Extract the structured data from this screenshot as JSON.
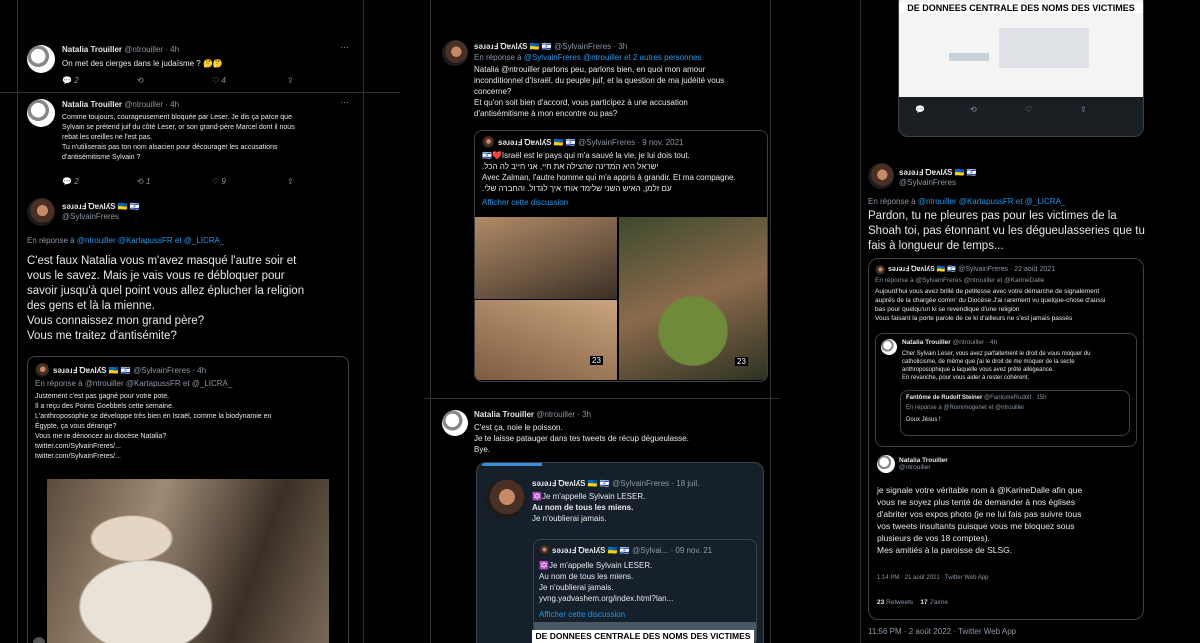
{
  "col1": {
    "t1": {
      "name": "Natalia Trouiller",
      "handle": "@ntrouiller · 4h",
      "text": "On met des cierges dans le judaïsme ? 🤔🤔",
      "replies": "2",
      "retweets": "",
      "likes": "4"
    },
    "t2": {
      "name": "Natalia Trouiller",
      "handle": "@ntrouiller · 4h",
      "lines": [
        "Comme toujours, courageusement bloquée par Leser. Je dis ça parce que",
        "Sylvain se prétend juif du côté Leser, or son grand-père Marcel dont il nous",
        "rebat les oreilles ne l'est pas.",
        "Tu n'utiliserais pas ton nom alsacien pour décourager les accusations",
        "d'antisémitisme Sylvain ?"
      ],
      "replies": "2",
      "retweets": "1",
      "likes": "9"
    },
    "t3": {
      "name": "səɹəɹℲ ꝹɐʌlʎS 🇺🇦 🇮🇱",
      "handle": "@SylvainFreres",
      "reply_prefix": "En réponse à",
      "reply_to": "@ntrouiller @KartapussFR  et  @_LICRA_",
      "lines": [
        "C'est faux Natalia vous m'avez masqué l'autre soir et",
        "vous le savez. Mais je vais vous re débloquer pour",
        "savoir jusqu'à quel point vous allez éplucher la religion",
        "des gens et là la mienne.",
        "Vous connaissez mon grand père?",
        "Vous me traitez d'antisémite?"
      ]
    },
    "quote": {
      "name": "səɹəɹℲ ꝹɐʌlʎS 🇺🇦 🇮🇱",
      "handle": "@SylvainFreres · 4h",
      "reply_line": "En réponse à @ntrouiller @KartapussFR  et  @_LICRA_",
      "lines": [
        "Justement c'est pas gagné pour votre pote.",
        "Il a reçu des Points Goebbels cette semaine.",
        "L'anthroposophie se développe très bien en Israël, comme la biodynamie en",
        "Égypte, ça vous dérange?",
        "Vous me re dénoncez au diocèse Natalia?",
        "twitter.com/SylvainFreres/...",
        "twitter.com/SylvainFreres/..."
      ]
    }
  },
  "col2": {
    "t1": {
      "name": "səɹəɹℲ ꝹɐʌlʎS 🇺🇦 🇮🇱",
      "handle": "@SylvainFreres · 3h",
      "reply_prefix": "En réponse à",
      "reply_to": "@SylvainFreres @ntrouiller  et 2 autres personnes",
      "lines": [
        "Natalia @ntrouiller parlons peu, parlons bien, en quoi mon amour",
        "inconditionnel d'Israël, du peuple juif, et la question de ma judéité vous",
        "concerne?",
        "Et qu'on soit bien d'accord, vous participez à une accusation",
        "d'antisémitisme à mon encontre ou pas?"
      ]
    },
    "quote": {
      "name": "səɹəɹℲ ꝹɐʌlʎS 🇺🇦 🇮🇱",
      "handle": "@SylvainFreres · 9 nov. 2021",
      "lines": [
        "🇮🇱❤️Israël est le pays qui m'a sauvé la vie, je lui dois tout.",
        "ישראל היא המדינה שהצילה את חיי, אני חייב לה הכל.",
        "Avec Zalman, l'autre homme qui m'a appris à grandir. Et ma compagne.",
        "עם זלמן, האיש השני שלימד אותי איך לגדול. והחברה שלי."
      ],
      "show_thread": "Afficher cette discussion",
      "badge_a": "23",
      "badge_b": "23"
    },
    "t2": {
      "name": "Natalia Trouiller",
      "handle": "@ntrouiller · 3h",
      "lines": [
        "C'est ça, noie le poisson.",
        "Je te laisse patauger dans tes tweets de récup dégueulasse.",
        "Bye."
      ]
    },
    "quote2": {
      "name": "səɹəɹℲ ꝹɐʌlʎS 🇺🇦 🇮🇱",
      "handle": "@SylvainFreres · 18 juil.",
      "lines": [
        "🔯Je m'appelle Sylvain LESER.",
        "Au nom de tous les miens.",
        "Je n'oublierai jamais."
      ]
    },
    "quote3": {
      "name": "səɹəɹℲ ꝹɐʌlʎS 🇺🇦 🇮🇱",
      "handle": "@Sylvai... · 09 nov. 21",
      "lines": [
        "🔯Je m'appelle Sylvain LESER.",
        "Au nom de tous les miens.",
        "Je n'oublierai jamais.",
        "yvng.yadvashem.org/index.html?lan..."
      ],
      "show_thread": "Afficher cette discussion"
    },
    "banner": "DE DONNEES CENTRALE DES NOMS DES VICTIMES"
  },
  "col3": {
    "banner": "DE DONNEES CENTRALE DES NOMS DES VICTIMES",
    "t1": {
      "name": "səɹəɹℲ ꝹɐʌlʎS 🇺🇦 🇮🇱",
      "handle": "@SylvainFreres",
      "reply_prefix": "En réponse à",
      "reply_to": "@ntrouiller @KartapussFR  et  @_LICRA_",
      "lines": [
        "Pardon, tu ne pleures pas pour les victimes de la",
        "Shoah toi, pas étonnant vu les dégueulasseries que tu",
        "fais à longueur de temps..."
      ]
    },
    "shot": {
      "name": "səɹəɹℲ ꝹɐʌlʎS 🇺🇦 🇮🇱",
      "handle": "@SylvainFreres · 22 août 2021",
      "reply_line": "En réponse à @SylvainFreres @ntrouiller  et  @KarineDalle",
      "lines": [
        "Aujourd'hui vous avez brillé de petitesse avec votre démarche de signalement",
        "auprès de la chargée comm' du Diocèse J'ai rarement vu quelque-chose d'aussi",
        "bas pour quelqu'un ki se revendique d'une religion",
        "Vous faisant la porte parole de ce ki d'ailleurs ne s'est jamais passés"
      ],
      "inner_name": "Natalia Trouiller",
      "inner_handle": "@ntrouiller · 4h",
      "inner_lines": [
        "Cher Sylvain Leser, vous avez parfaitement le droit de vous moquer du",
        "catholicisme, de même que j'ai le droit de me moquer de la secte",
        "anthroposophique à laquelle vous avez prêté allégeance.",
        "En revanche, pour vous aider à rester cohérent,"
      ],
      "ghost_name": "Fantôme de Rudolf Steiner",
      "ghost_handle": "@FantomeRudolf · 15h",
      "ghost_reply": "En réponse à @Romimogenet  et  @ntrouiller",
      "ghost_text": "Doux Jésus !",
      "nt_name": "Natalia Trouiller",
      "nt_handle": "@ntrouiller",
      "big_lines": [
        "je signale votre véritable nom à @KarineDalle afin que",
        "vous ne soyez plus tenté de demander à nos églises",
        "d'abriter vos expos photo (je ne lui fais pas suivre tous",
        "vos tweets insultants puisque vous me bloquez sous",
        "plusieurs de vos 18 comptes).",
        "Mes amitiés à la paroisse de SLSG."
      ],
      "footer": "1:14 PM · 21 août 2021 · Twitter Web App",
      "rt_count": "23",
      "rt_label": "Retweets",
      "like_count": "17",
      "like_label": "J'aime"
    },
    "footer": "11:56 PM · 2 août 2022 · Twitter Web App"
  }
}
